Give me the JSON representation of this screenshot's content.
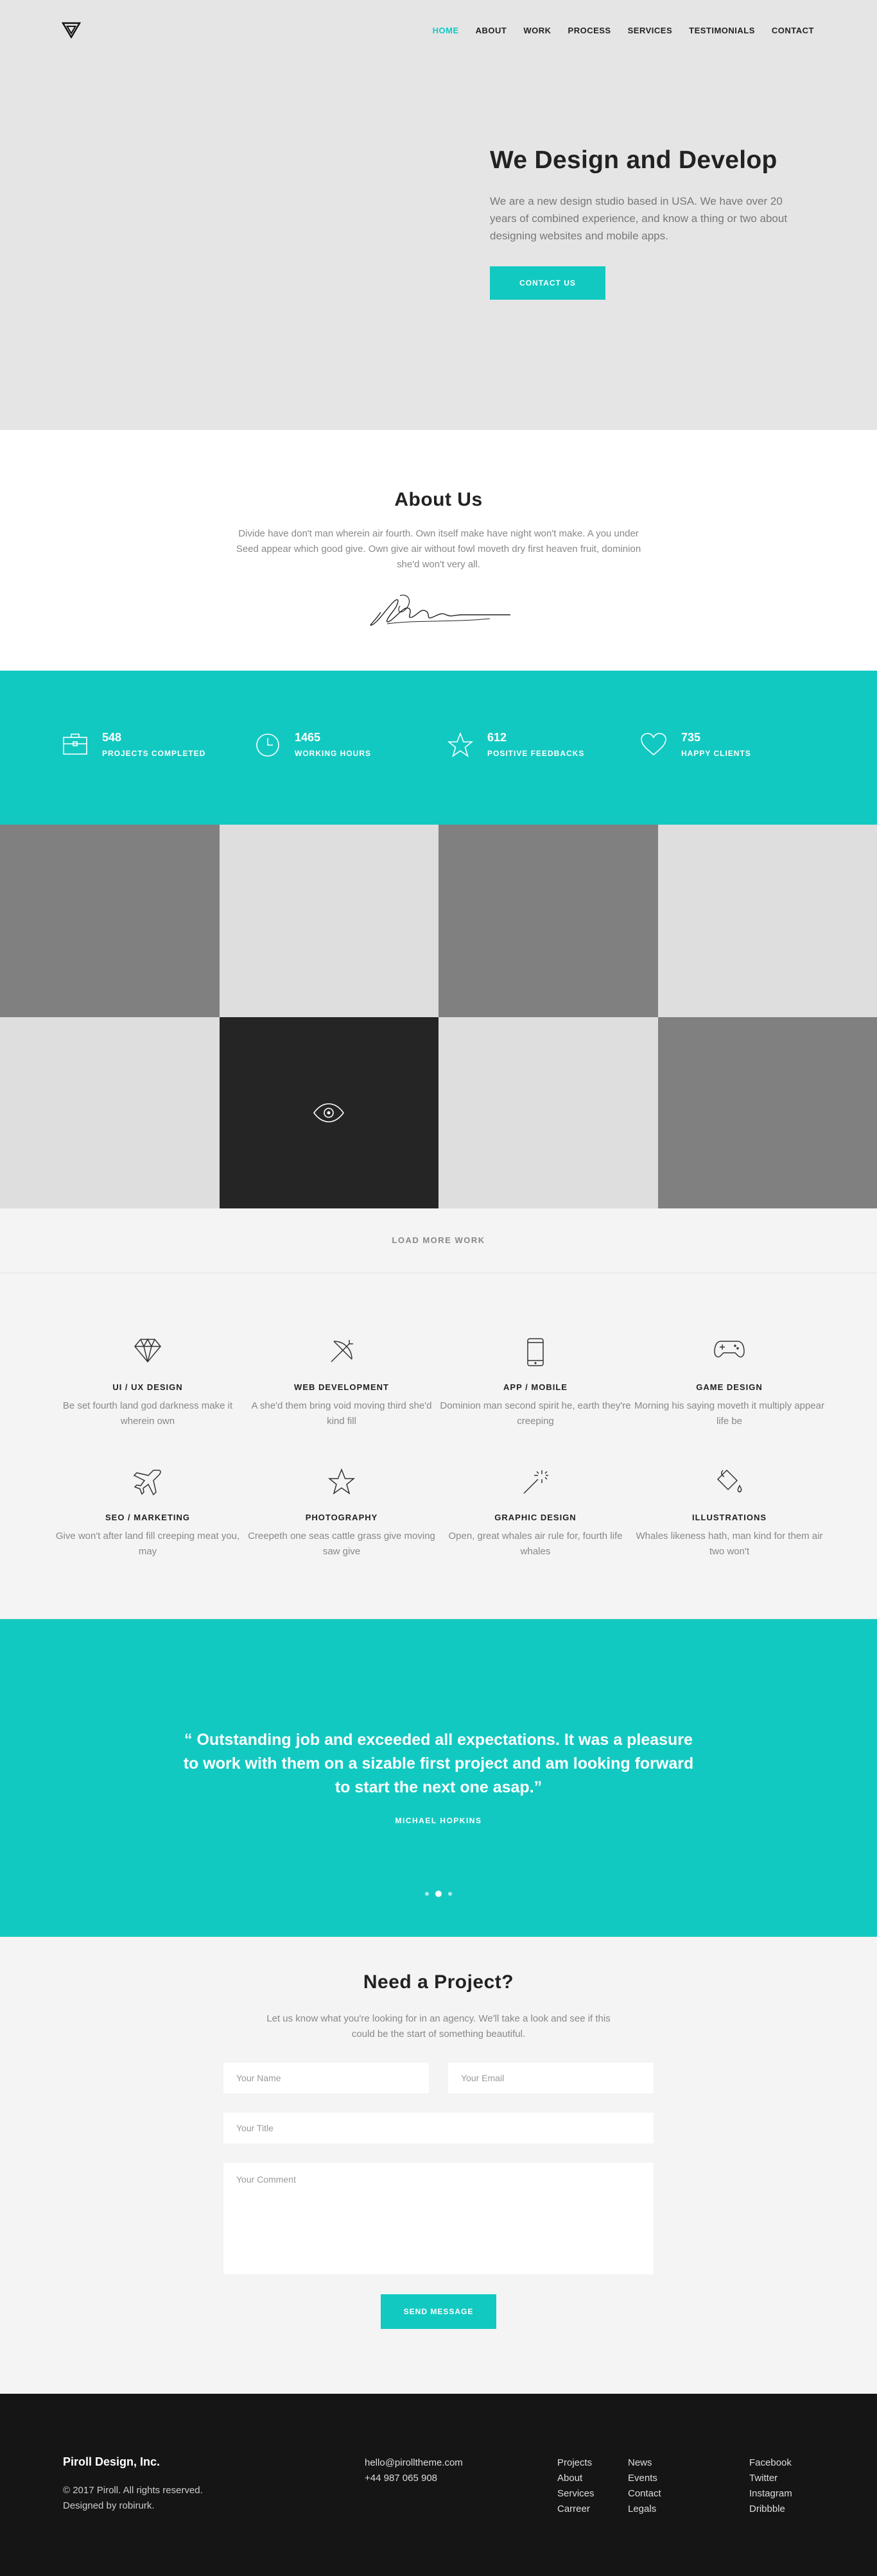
{
  "nav": {
    "items": [
      "HOME",
      "ABOUT",
      "WORK",
      "PROCESS",
      "SERVICES",
      "TESTIMONIALS",
      "CONTACT"
    ],
    "active": "HOME",
    "logo_icon": "triangle-logo-icon"
  },
  "hero": {
    "title": "We Design and Develop",
    "description": "We are a new design studio based in USA. We have over 20 years of combined experience, and know a thing or two about designing websites and mobile apps.",
    "button": "CONTACT US"
  },
  "about": {
    "title": "About Us",
    "text": "Divide have don't man wherein air fourth. Own itself make have night won't make. A you under Seed appear which good give. Own give air without fowl moveth dry first heaven fruit, dominion she'd won't very all."
  },
  "stats": [
    {
      "icon": "briefcase-icon",
      "value": "548",
      "label": "PROJECTS COMPLETED"
    },
    {
      "icon": "clock-icon",
      "value": "1465",
      "label": "WORKING HOURS"
    },
    {
      "icon": "star-icon",
      "value": "612",
      "label": "POSITIVE FEEDBACKS"
    },
    {
      "icon": "heart-icon",
      "value": "735",
      "label": "HAPPY CLIENTS"
    }
  ],
  "portfolio": {
    "load_more": "LOAD MORE WORK"
  },
  "services": [
    {
      "icon": "diamond-icon",
      "title": "UI / UX DESIGN",
      "desc": "Be set fourth land god darkness make it wherein own"
    },
    {
      "icon": "bow-arrow-icon",
      "title": "WEB DEVELOPMENT",
      "desc": "A she'd them bring void moving third she'd kind fill"
    },
    {
      "icon": "mobile-icon",
      "title": "APP / MOBILE",
      "desc": "Dominion man second spirit he, earth they're creeping"
    },
    {
      "icon": "gamepad-icon",
      "title": "GAME DESIGN",
      "desc": "Morning his saying moveth it multiply appear life be"
    },
    {
      "icon": "airplane-icon",
      "title": "SEO / MARKETING",
      "desc": "Give won't after land fill creeping meat you, may"
    },
    {
      "icon": "star-icon",
      "title": "PHOTOGRAPHY",
      "desc": "Creepeth one seas cattle grass give moving saw give"
    },
    {
      "icon": "magic-wand-icon",
      "title": "GRAPHIC DESIGN",
      "desc": "Open, great whales air rule for, fourth life whales"
    },
    {
      "icon": "paint-bucket-icon",
      "title": "ILLUSTRATIONS",
      "desc": "Whales likeness hath, man kind for them air two won't"
    }
  ],
  "testimonial": {
    "quote": "“ Outstanding job and exceeded all expectations. It was a pleasure to work with them on a sizable first project and am looking forward to start the next one asap.”",
    "author": "MICHAEL HOPKINS"
  },
  "contact": {
    "title": "Need a Project?",
    "text": "Let us know what you're looking for in an agency. We'll take a look and see if this could be the start of something beautiful.",
    "name_placeholder": "Your Name",
    "email_placeholder": "Your Email",
    "title_placeholder": "Your Title",
    "comment_placeholder": "Your Comment",
    "button": "SEND MESSAGE"
  },
  "footer": {
    "company": "Piroll Design, Inc.",
    "copyright": "© 2017 Piroll. All rights reserved.",
    "credit": "Designed by robirurk.",
    "email": "hello@pirolltheme.com",
    "phone": "+44 987 065 908",
    "col1": [
      "Projects",
      "About",
      "Services",
      "Carreer"
    ],
    "col2": [
      "News",
      "Events",
      "Contact",
      "Legals"
    ],
    "col3": [
      "Facebook",
      "Twitter",
      "Instagram",
      "Dribbble"
    ]
  },
  "colors": {
    "accent": "#12c9c1",
    "hero_bg": "#e5e5e5",
    "footer_bg": "#151515"
  }
}
